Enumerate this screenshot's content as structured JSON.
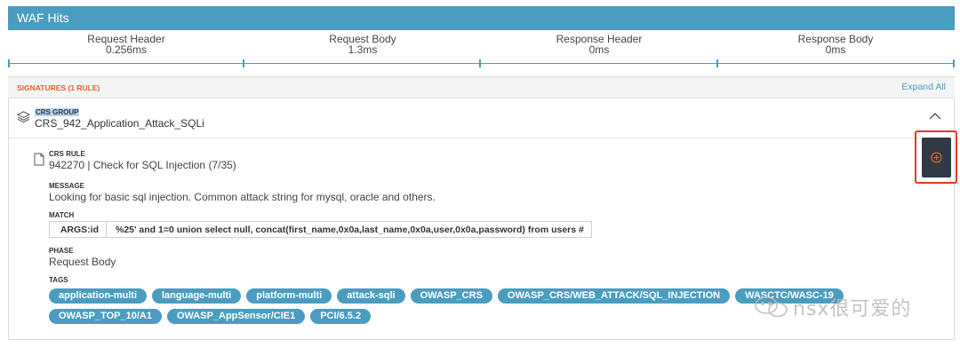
{
  "header": {
    "title": "WAF Hits"
  },
  "timeline": [
    {
      "label": "Request Header",
      "value": "0.256ms"
    },
    {
      "label": "Request Body",
      "value": "1.3ms"
    },
    {
      "label": "Response Header",
      "value": "0ms"
    },
    {
      "label": "Response Body",
      "value": "0ms"
    }
  ],
  "signatures": {
    "title": "SIGNATURES (1 RULE)",
    "expand_all": "Expand All"
  },
  "group": {
    "label": "CRS GROUP",
    "name": "CRS_942_Application_Attack_SQLi"
  },
  "rule": {
    "label": "CRS RULE",
    "name": "942270 | Check for SQL Injection (7/35)",
    "message_label": "MESSAGE",
    "message": "Looking for basic sql injection. Common attack string for mysql, oracle and others.",
    "match_label": "MATCH",
    "match_key": "ARGS:id",
    "match_value": "%25' and 1=0 union select null, concat(first_name,0x0a,last_name,0x0a,user,0x0a,password) from users #",
    "phase_label": "PHASE",
    "phase": "Request Body",
    "tags_label": "TAGS",
    "tags_row1": [
      "application-multi",
      "language-multi",
      "platform-multi",
      "attack-sqli",
      "OWASP_CRS",
      "OWASP_CRS/WEB_ATTACK/SQL_INJECTION",
      "WASCTC/WASC-19"
    ],
    "tags_row2": [
      "OWASP_TOP_10/A1",
      "OWASP_AppSensor/CIE1",
      "PCI/6.5.2"
    ]
  },
  "watermark": {
    "text": "nsx很可爱的"
  },
  "colors": {
    "accent": "#4a9dc0",
    "signature_title": "#e8602c",
    "highlight": "#e23a1f",
    "button_bg": "#2f3a46"
  },
  "icons": {
    "group": "layers-icon",
    "rule": "document-icon",
    "collapse": "chevron-up-icon",
    "action": "plus-circle-icon"
  }
}
